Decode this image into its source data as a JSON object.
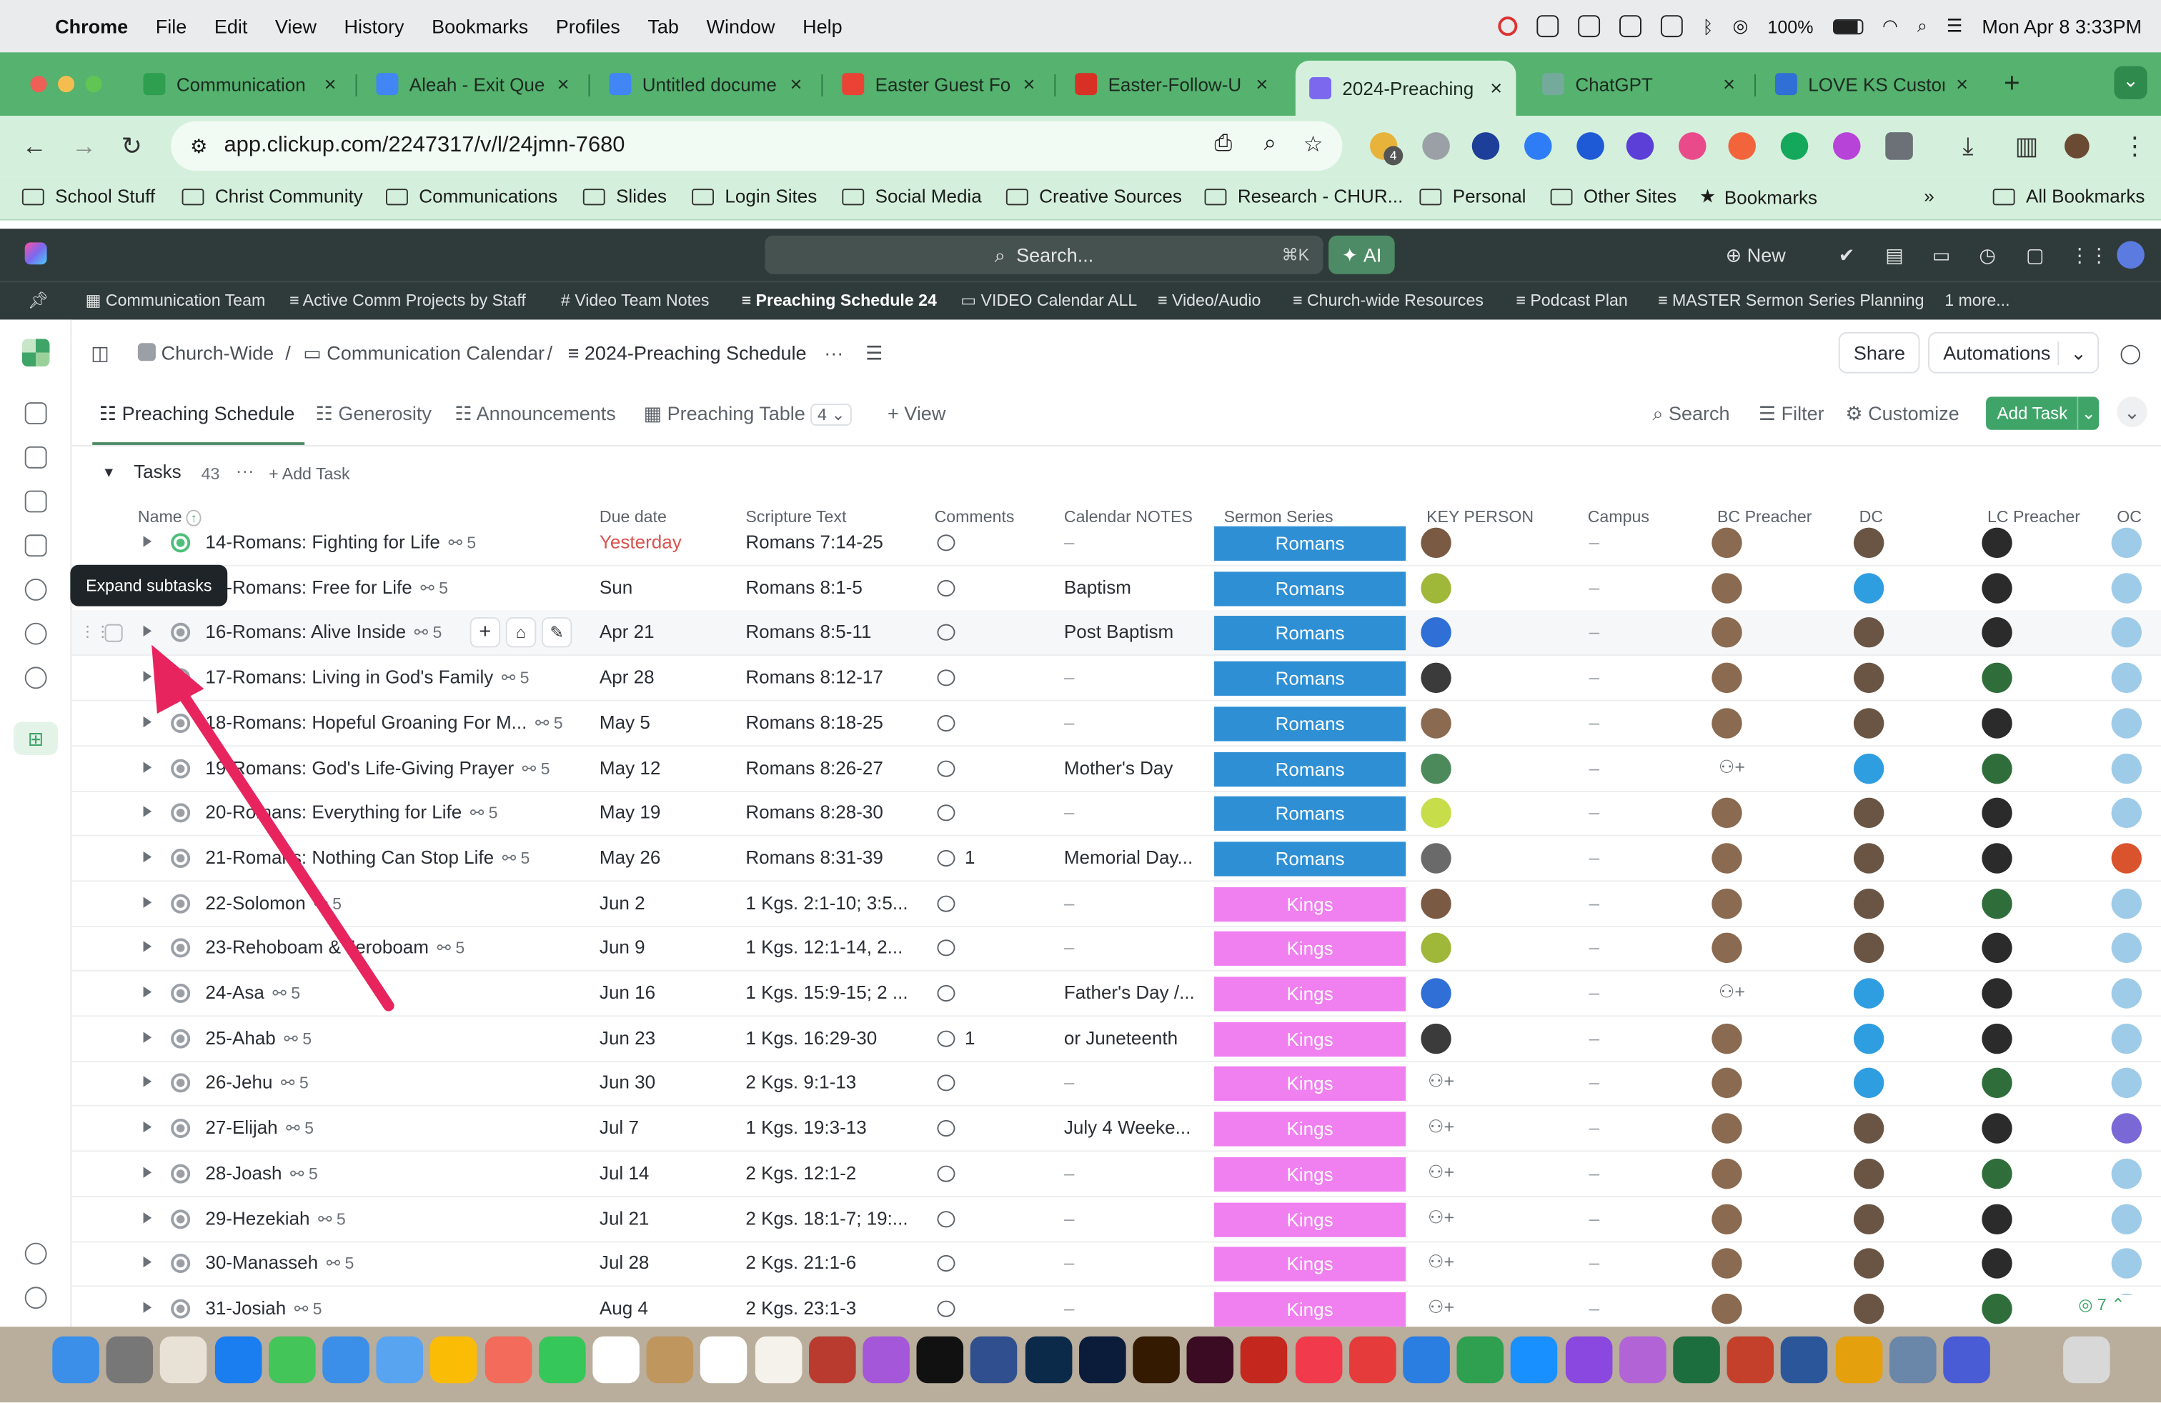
{
  "menubar": {
    "app": "Chrome",
    "items": [
      "File",
      "Edit",
      "View",
      "History",
      "Bookmarks",
      "Profiles",
      "Tab",
      "Window",
      "Help"
    ],
    "battery": "100%",
    "datetime": "Mon Apr 8  3:33PM"
  },
  "browser": {
    "tabs": [
      {
        "title": "Communication",
        "color": "#2e9e4f"
      },
      {
        "title": "Aleah - Exit Que",
        "color": "#4285f4"
      },
      {
        "title": "Untitled docume",
        "color": "#4285f4"
      },
      {
        "title": "Easter Guest Fo",
        "color": "#ea4335"
      },
      {
        "title": "Easter-Follow-U",
        "color": "#d93025"
      },
      {
        "title": "2024-Preaching",
        "color": "#7b68ee"
      },
      {
        "title": "ChatGPT",
        "color": "#74aa9c"
      },
      {
        "title": "LOVE KS Custom",
        "color": "#2f6fd6"
      }
    ],
    "url": "app.clickup.com/2247317/v/l/24jmn-7680",
    "ext_badge": "4",
    "bookmarks": [
      "School Stuff",
      "Christ Community",
      "Communications",
      "Slides",
      "Login Sites",
      "Social Media",
      "Creative Sources",
      "Research - CHUR...",
      "Personal",
      "Other Sites",
      "Bookmarks"
    ],
    "all_bookmarks": "All Bookmarks"
  },
  "clickup": {
    "search_placeholder": "Search...",
    "search_shortcut": "⌘K",
    "ai_label": "AI",
    "new_label": "New",
    "favorites": [
      "Communication Team",
      "Active Comm Projects by Staff",
      "Video Team Notes",
      "Preaching Schedule 24",
      "VIDEO Calendar ALL",
      "Video/Audio",
      "Church-wide Resources",
      "Podcast Plan",
      "MASTER Sermon Series Planning",
      "1 more..."
    ],
    "breadcrumb": [
      "Church-Wide",
      "Communication Calendar",
      "2024-Preaching Schedule"
    ],
    "share": "Share",
    "automations": "Automations",
    "views": [
      "Preaching Schedule",
      "Generosity",
      "Announcements",
      "Preaching Table"
    ],
    "views_more_count": "4",
    "add_view": "View",
    "search": "Search",
    "filter": "Filter",
    "customize": "Customize",
    "add_task_btn": "Add Task",
    "group_name": "Tasks",
    "group_count": "43",
    "add_task_inline": "Add Task",
    "tooltip": "Expand subtasks",
    "columns": [
      "Name",
      "Due date",
      "Scripture Text",
      "Comments",
      "Calendar NOTES",
      "Sermon Series",
      "KEY PERSON",
      "Campus",
      "BC Preacher",
      "DC",
      "LC Preacher",
      "OC"
    ],
    "bottom_count": "7",
    "series_colors": {
      "Romans": "#2e8fd4",
      "Kings": "#f07ff0"
    },
    "tasks": [
      {
        "name": "14-Romans: Fighting for Life",
        "subs": "5",
        "due": "Yesterday",
        "scripture": "Romans 7:14-25",
        "comments": "",
        "notes": "–",
        "series": "Romans"
      },
      {
        "name": "15-Romans: Free for Life",
        "subs": "5",
        "due": "Sun",
        "scripture": "Romans 8:1-5",
        "comments": "",
        "notes": "Baptism",
        "series": "Romans"
      },
      {
        "name": "16-Romans: Alive Inside",
        "subs": "5",
        "due": "Apr 21",
        "scripture": "Romans 8:5-11",
        "comments": "",
        "notes": "Post Baptism",
        "series": "Romans"
      },
      {
        "name": "17-Romans: Living in God's Family",
        "subs": "5",
        "due": "Apr 28",
        "scripture": "Romans 8:12-17",
        "comments": "",
        "notes": "–",
        "series": "Romans"
      },
      {
        "name": "18-Romans: Hopeful Groaning For M...",
        "subs": "5",
        "due": "May 5",
        "scripture": "Romans 8:18-25",
        "comments": "",
        "notes": "–",
        "series": "Romans"
      },
      {
        "name": "19-Romans: God's Life-Giving Prayer",
        "subs": "5",
        "due": "May 12",
        "scripture": "Romans 8:26-27",
        "comments": "",
        "notes": "Mother's Day",
        "series": "Romans"
      },
      {
        "name": "20-Romans: Everything for Life",
        "subs": "5",
        "due": "May 19",
        "scripture": "Romans 8:28-30",
        "comments": "",
        "notes": "–",
        "series": "Romans"
      },
      {
        "name": "21-Romans: Nothing Can Stop Life",
        "subs": "5",
        "due": "May 26",
        "scripture": "Romans 8:31-39",
        "comments": "1",
        "notes": "Memorial Day...",
        "series": "Romans"
      },
      {
        "name": "22-Solomon",
        "subs": "5",
        "due": "Jun 2",
        "scripture": "1 Kgs. 2:1-10; 3:5...",
        "comments": "",
        "notes": "–",
        "series": "Kings"
      },
      {
        "name": "23-Rehoboam & Jeroboam",
        "subs": "5",
        "due": "Jun 9",
        "scripture": "1 Kgs. 12:1-14, 2...",
        "comments": "",
        "notes": "–",
        "series": "Kings"
      },
      {
        "name": "24-Asa",
        "subs": "5",
        "due": "Jun 16",
        "scripture": "1 Kgs. 15:9-15; 2 ...",
        "comments": "",
        "notes": "Father's Day /...",
        "series": "Kings"
      },
      {
        "name": "25-Ahab",
        "subs": "5",
        "due": "Jun 23",
        "scripture": "1 Kgs. 16:29-30",
        "comments": "1",
        "notes": "or Juneteenth",
        "series": "Kings"
      },
      {
        "name": "26-Jehu",
        "subs": "5",
        "due": "Jun 30",
        "scripture": "2 Kgs. 9:1-13",
        "comments": "",
        "notes": "–",
        "series": "Kings"
      },
      {
        "name": "27-Elijah",
        "subs": "5",
        "due": "Jul 7",
        "scripture": "1 Kgs. 19:3-13",
        "comments": "",
        "notes": "July 4 Weeke...",
        "series": "Kings"
      },
      {
        "name": "28-Joash",
        "subs": "5",
        "due": "Jul 14",
        "scripture": "2 Kgs. 12:1-2",
        "comments": "",
        "notes": "–",
        "series": "Kings"
      },
      {
        "name": "29-Hezekiah",
        "subs": "5",
        "due": "Jul 21",
        "scripture": "2 Kgs. 18:1-7; 19:...",
        "comments": "",
        "notes": "–",
        "series": "Kings"
      },
      {
        "name": "30-Manasseh",
        "subs": "5",
        "due": "Jul 28",
        "scripture": "2 Kgs. 21:1-6",
        "comments": "",
        "notes": "–",
        "series": "Kings"
      },
      {
        "name": "31-Josiah",
        "subs": "5",
        "due": "Aug 4",
        "scripture": "2 Kgs. 23:1-3",
        "comments": "",
        "notes": "–",
        "series": "Kings"
      }
    ]
  }
}
